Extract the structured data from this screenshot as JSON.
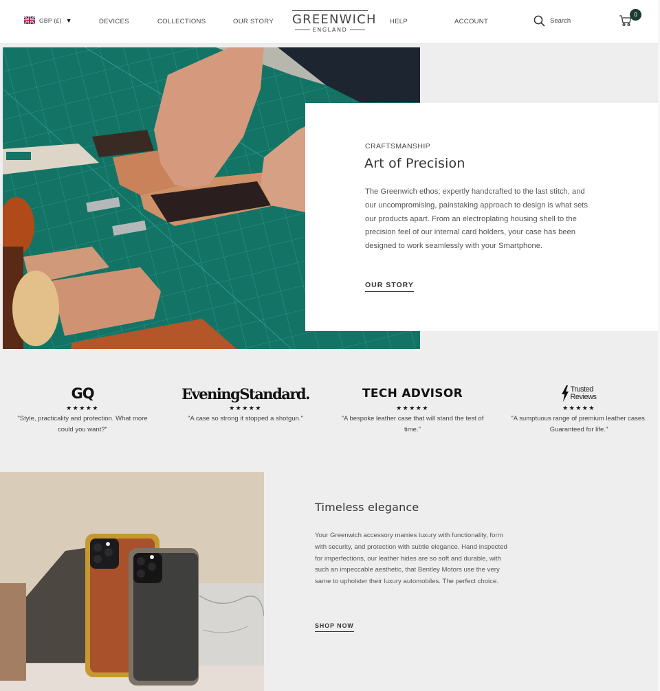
{
  "header": {
    "currency": {
      "label": "GBP (£)",
      "flag": "uk-flag-icon",
      "caret": "▼"
    },
    "nav": [
      "DEVICES",
      "COLLECTIONS",
      "OUR STORY",
      "HELP",
      "ACCOUNT"
    ],
    "logo": {
      "name": "GREENWICH",
      "sub": "ENGLAND"
    },
    "search": {
      "icon": "search-icon",
      "label": "Search"
    },
    "cart": {
      "icon": "cart-icon",
      "count": "0",
      "badge_color": "#1d3b33"
    }
  },
  "hero": {
    "image_alt": "Hands assembling leather phone case on green cutting mat",
    "eyebrow": "CRAFTSMANSHIP",
    "title": "Art of Precision",
    "body": "The Greenwich ethos; expertly handcrafted to the last stitch, and our uncompromising, painstaking approach to design is what sets our products apart. From an electroplating housing shell to the precision feel of our internal card holders, your case has been designed to work seamlessly with your Smartphone.",
    "cta": "OUR STORY"
  },
  "press": [
    {
      "publication": "GQ",
      "stars": "★★★★★",
      "rating": 5,
      "quote": "\"Style, practicality and protection. What more could you want?\""
    },
    {
      "publication": "EveningStandard",
      "stars": "★★★★★",
      "rating": 5,
      "quote": "\"A case so strong it stopped a shotgun.\""
    },
    {
      "publication": "TECH ADVISOR",
      "stars": "★★★★★",
      "rating": 5,
      "quote": "\"A bespoke leather case that will stand the test of time.\""
    },
    {
      "publication": "Trusted Reviews",
      "line1": "Trusted",
      "line2": "Reviews",
      "stars": "★★★★★",
      "rating": 5,
      "quote": "\"A sumptuous range of premium leather cases. Guaranteed for life.\""
    }
  ],
  "elegance": {
    "image_alt": "Tan and black leather phone cases among stone blocks",
    "title": "Timeless elegance",
    "body": "Your Greenwich accessory marries luxury with functionality, form with security, and protection with subtle elegance. Hand inspected for imperfections, our leather hides are so soft and durable, with such an impeccable aesthetic, that Bentley Motors use the very same to upholster their luxury automobiles. The perfect choice.",
    "cta": "SHOP NOW"
  },
  "colors": {
    "accent": "#1d3b33",
    "es_dot": "#e0102b",
    "page_bg": "#eeeeee"
  }
}
